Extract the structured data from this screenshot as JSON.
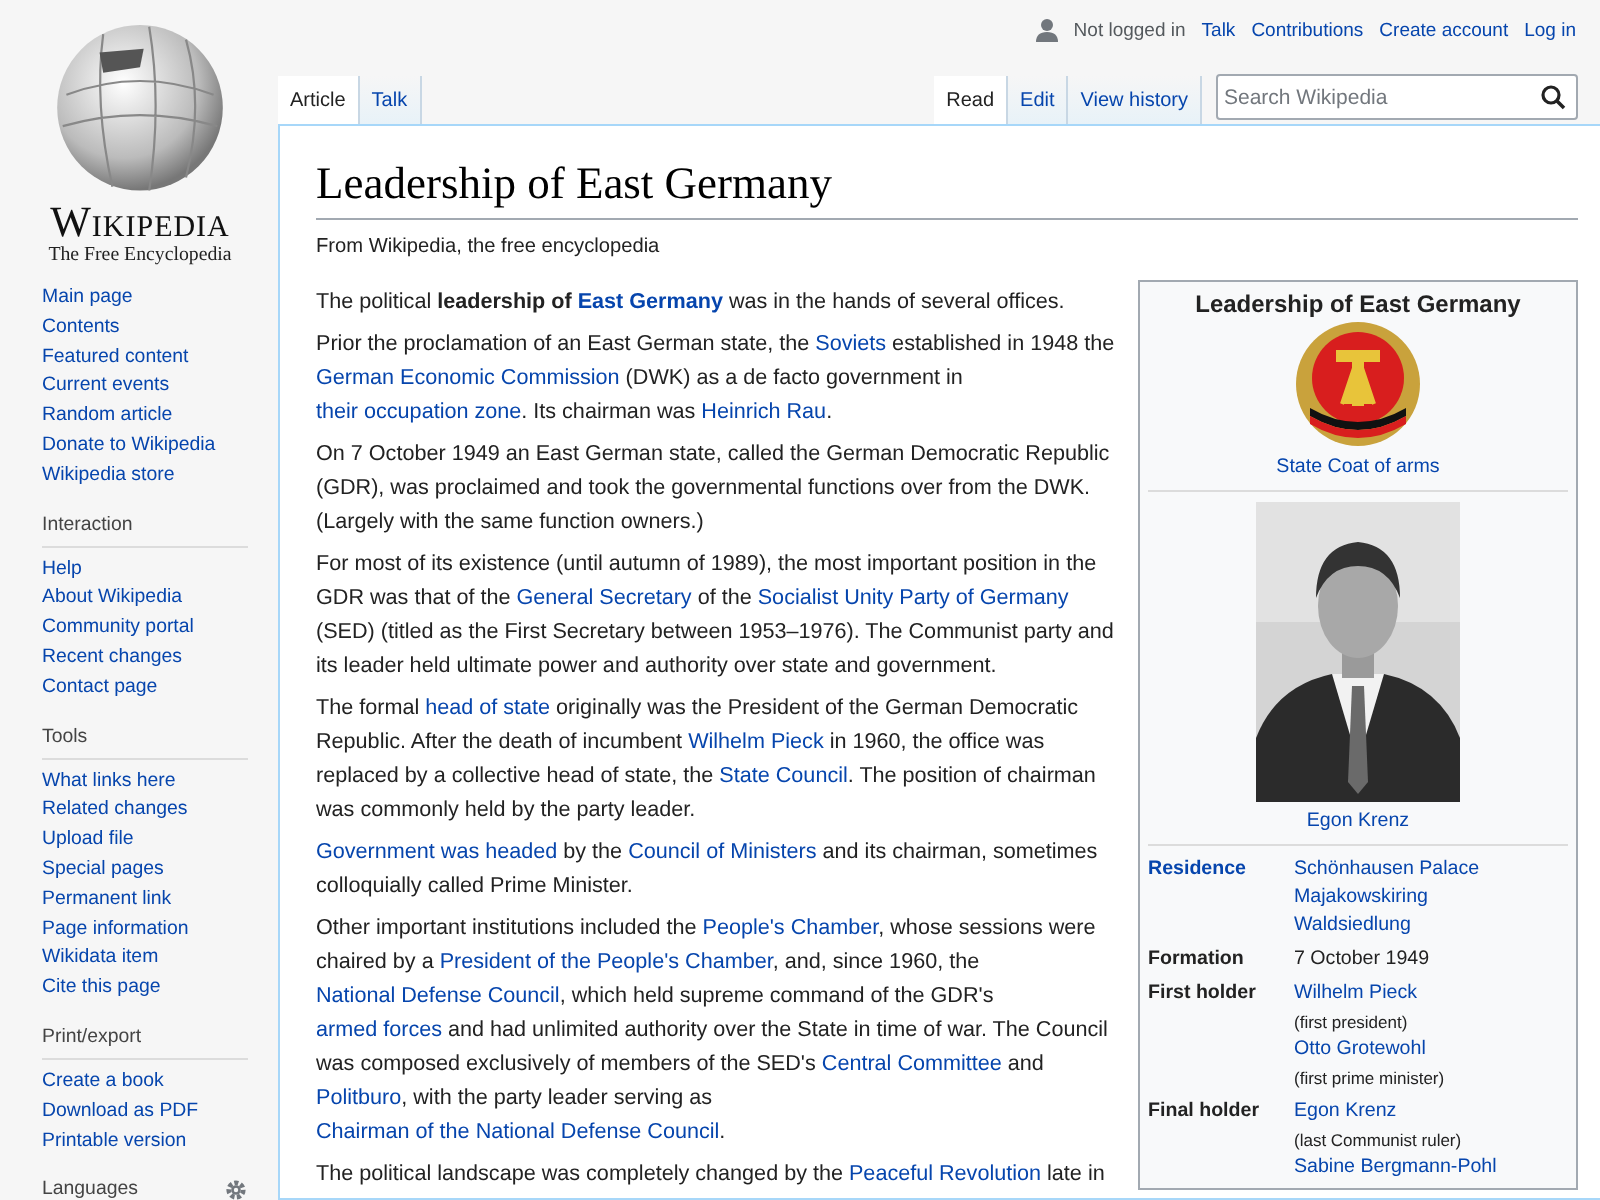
{
  "personal_tools": {
    "status": "Not logged in",
    "links": [
      "Talk",
      "Contributions",
      "Create account",
      "Log in"
    ]
  },
  "logo": {
    "wordmark": "Wikipedia",
    "tagline": "The Free Encyclopedia"
  },
  "namespace_tabs": [
    {
      "label": "Article",
      "selected": true
    },
    {
      "label": "Talk",
      "selected": false
    }
  ],
  "view_tabs": [
    {
      "label": "Read",
      "selected": true
    },
    {
      "label": "Edit",
      "selected": false
    },
    {
      "label": "View history",
      "selected": false
    }
  ],
  "search": {
    "placeholder": "Search Wikipedia"
  },
  "sidebar": {
    "navigation": [
      "Main page",
      "Contents",
      "Featured content",
      "Current events",
      "Random article",
      "Donate to Wikipedia",
      "Wikipedia store"
    ],
    "sections": [
      {
        "heading": "Interaction",
        "items": [
          "Help",
          "About Wikipedia",
          "Community portal",
          "Recent changes",
          "Contact page"
        ]
      },
      {
        "heading": "Tools",
        "items": [
          "What links here",
          "Related changes",
          "Upload file",
          "Special pages",
          "Permanent link",
          "Page information",
          "Wikidata item",
          "Cite this page"
        ]
      },
      {
        "heading": "Print/export",
        "items": [
          "Create a book",
          "Download as PDF",
          "Printable version"
        ]
      }
    ],
    "languages_heading": "Languages"
  },
  "article": {
    "title": "Leadership of East Germany",
    "tagline": "From Wikipedia, the free encyclopedia",
    "paragraphs": [
      [
        {
          "text": "The political ",
          "kind": "plain"
        },
        {
          "text": "leadership of ",
          "kind": "bold"
        },
        {
          "text": "East Germany",
          "kind": "boldlink"
        },
        {
          "text": " was in the hands of several offices.",
          "kind": "plain"
        }
      ],
      [
        {
          "text": "Prior the proclamation of an East German state, the ",
          "kind": "plain"
        },
        {
          "text": "Soviets",
          "kind": "link"
        },
        {
          "text": " established in 1948 the ",
          "kind": "plain"
        },
        {
          "text": "German Economic Commission",
          "kind": "link"
        },
        {
          "text": " (DWK) as a de facto government in ",
          "kind": "plain"
        },
        {
          "text": "their occupation zone",
          "kind": "link"
        },
        {
          "text": ". Its chairman was ",
          "kind": "plain"
        },
        {
          "text": "Heinrich Rau",
          "kind": "link"
        },
        {
          "text": ".",
          "kind": "plain"
        }
      ],
      [
        {
          "text": "On 7 October 1949 an East German state, called the German Democratic Republic (GDR), was proclaimed and took the governmental functions over from the DWK. (Largely with the same function owners.)",
          "kind": "plain"
        }
      ],
      [
        {
          "text": "For most of its existence (until autumn of 1989), the most important position in the GDR was that of the ",
          "kind": "plain"
        },
        {
          "text": "General Secretary",
          "kind": "link"
        },
        {
          "text": " of the ",
          "kind": "plain"
        },
        {
          "text": "Socialist Unity Party of Germany",
          "kind": "link"
        },
        {
          "text": " (SED) (titled as the First Secretary between 1953–1976). The Communist party and its leader held ultimate power and authority over state and government.",
          "kind": "plain"
        }
      ],
      [
        {
          "text": "The formal ",
          "kind": "plain"
        },
        {
          "text": "head of state",
          "kind": "link"
        },
        {
          "text": " originally was the President of the German Democratic Republic. After the death of incumbent ",
          "kind": "plain"
        },
        {
          "text": "Wilhelm Pieck",
          "kind": "link"
        },
        {
          "text": " in 1960, the office was replaced by a collective head of state, the ",
          "kind": "plain"
        },
        {
          "text": "State Council",
          "kind": "link"
        },
        {
          "text": ". The position of chairman was commonly held by the party leader.",
          "kind": "plain"
        }
      ],
      [
        {
          "text": "Government was headed",
          "kind": "link"
        },
        {
          "text": " by the ",
          "kind": "plain"
        },
        {
          "text": "Council of Ministers",
          "kind": "link"
        },
        {
          "text": " and its chairman, sometimes colloquially called Prime Minister.",
          "kind": "plain"
        }
      ],
      [
        {
          "text": "Other important institutions included the ",
          "kind": "plain"
        },
        {
          "text": "People's Chamber",
          "kind": "link"
        },
        {
          "text": ", whose sessions were chaired by a ",
          "kind": "plain"
        },
        {
          "text": "President of the People's Chamber",
          "kind": "link"
        },
        {
          "text": ", and, since 1960, the ",
          "kind": "plain"
        },
        {
          "text": "National Defense Council",
          "kind": "link"
        },
        {
          "text": ", which held supreme command of the GDR's ",
          "kind": "plain"
        },
        {
          "text": "armed forces",
          "kind": "link"
        },
        {
          "text": " and had unlimited authority over the State in time of war. The Council was composed exclusively of members of the SED's ",
          "kind": "plain"
        },
        {
          "text": "Central Committee",
          "kind": "link"
        },
        {
          "text": " and ",
          "kind": "plain"
        },
        {
          "text": "Politburo",
          "kind": "link"
        },
        {
          "text": ", with the party leader serving as ",
          "kind": "plain"
        },
        {
          "text": "Chairman of the National Defense Council",
          "kind": "link"
        },
        {
          "text": ".",
          "kind": "plain"
        }
      ],
      [
        {
          "text": "The political landscape was completely changed by the ",
          "kind": "plain"
        },
        {
          "text": "Peaceful Revolution",
          "kind": "link"
        },
        {
          "text": " late in",
          "kind": "plain"
        }
      ]
    ]
  },
  "infobox": {
    "title": "Leadership of East Germany",
    "emblem_caption": "State Coat of arms",
    "photo_caption": "Egon Krenz",
    "rows": [
      {
        "label": "Residence",
        "link": true,
        "values": [
          {
            "text": "Schönhausen Palace",
            "kind": "link"
          },
          {
            "text": "Majakowskiring",
            "kind": "link"
          },
          {
            "text": "Waldsiedlung",
            "kind": "link"
          }
        ]
      },
      {
        "label": "Formation",
        "link": false,
        "values": [
          {
            "text": "7 October 1949",
            "kind": "text"
          }
        ]
      },
      {
        "label": "First holder",
        "link": false,
        "values": [
          {
            "text": "Wilhelm Pieck",
            "kind": "link"
          },
          {
            "text": "(first president)",
            "kind": "note"
          },
          {
            "text": "Otto Grotewohl",
            "kind": "link"
          },
          {
            "text": "(first prime minister)",
            "kind": "note"
          }
        ]
      },
      {
        "label": "Final holder",
        "link": false,
        "values": [
          {
            "text": "Egon Krenz",
            "kind": "link"
          },
          {
            "text": "(last Communist ruler)",
            "kind": "note"
          },
          {
            "text": "Sabine Bergmann-Pohl",
            "kind": "link"
          }
        ]
      }
    ]
  }
}
